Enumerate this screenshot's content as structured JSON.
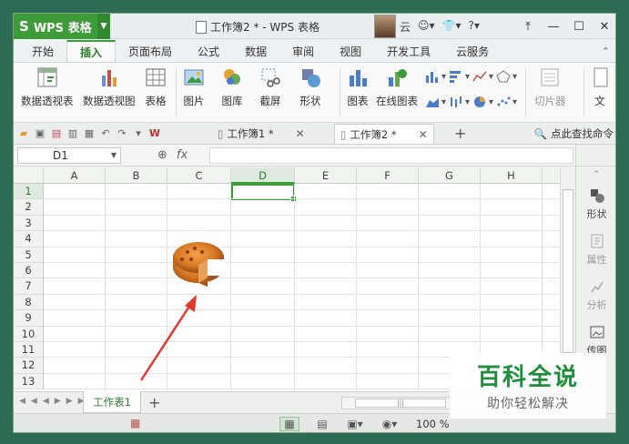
{
  "app": {
    "menu_button_label": "WPS 表格",
    "menu_button_logo": "S",
    "document_title": "工作簿2 * - WPS 表格",
    "cloud_label": "云"
  },
  "menu_tabs": [
    "开始",
    "插入",
    "页面布局",
    "公式",
    "数据",
    "审阅",
    "视图",
    "开发工具",
    "云服务"
  ],
  "active_menu_tab": "插入",
  "ribbon": {
    "pivot_table": "数据透视表",
    "pivot_chart": "数据透视图",
    "table": "表格",
    "picture": "图片",
    "gallery": "图库",
    "screenshot": "截屏",
    "shapes": "形状",
    "chart": "图表",
    "online_chart": "在线图表",
    "slicer": "切片器",
    "text_partial": "文"
  },
  "doc_tabs": [
    {
      "label": "工作簿1 *",
      "active": false
    },
    {
      "label": "工作簿2 *",
      "active": true
    }
  ],
  "search_command": "点此查找命令",
  "formula_bar": {
    "name_box": "D1",
    "fx_label": "fx",
    "value": ""
  },
  "columns": [
    "A",
    "B",
    "C",
    "D",
    "E",
    "F",
    "G",
    "H"
  ],
  "selected_column": "D",
  "rows": [
    "1",
    "2",
    "3",
    "4",
    "5",
    "6",
    "7",
    "8",
    "9",
    "10",
    "11",
    "12",
    "13"
  ],
  "selected_row": "1",
  "side_panel": {
    "shape": "形状",
    "properties": "属性",
    "analysis": "分析",
    "gallery_partial": "传图"
  },
  "sheet_tabs": [
    "工作表1"
  ],
  "status": {
    "zoom": "100 %"
  },
  "watermark": {
    "title": "百科全说",
    "subtitle": "助你轻松解决"
  },
  "colors": {
    "accent": "#3d9b3a",
    "arrow": "#e03a2f",
    "watermark_green": "#1e8d3c"
  }
}
